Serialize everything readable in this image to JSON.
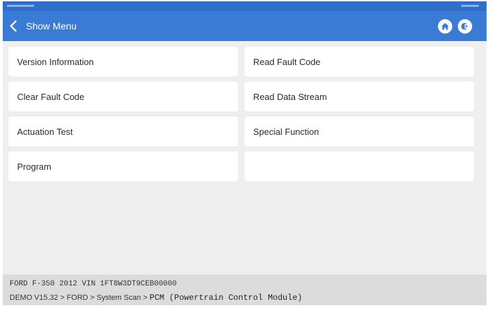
{
  "header": {
    "back_label": "Show Menu",
    "home_icon": "home-icon",
    "exit_icon": "exit-icon"
  },
  "menu": {
    "items": [
      {
        "label": "Version Information"
      },
      {
        "label": "Read Fault Code"
      },
      {
        "label": "Clear Fault Code"
      },
      {
        "label": "Read Data Stream"
      },
      {
        "label": "Actuation Test"
      },
      {
        "label": "Special Function"
      },
      {
        "label": "Program"
      },
      {
        "label": ""
      }
    ]
  },
  "footer": {
    "vehicle_line": "FORD  F-350  2012  VIN  1FT8W3DT9CEB00000",
    "path_prefix": "DEMO V15.32 > FORD > System Scan > ",
    "path_module": "PCM (Powertrain Control Module)"
  },
  "colors": {
    "appbar": "#3a7bd5",
    "background": "#efefef",
    "tile": "#ffffff"
  }
}
